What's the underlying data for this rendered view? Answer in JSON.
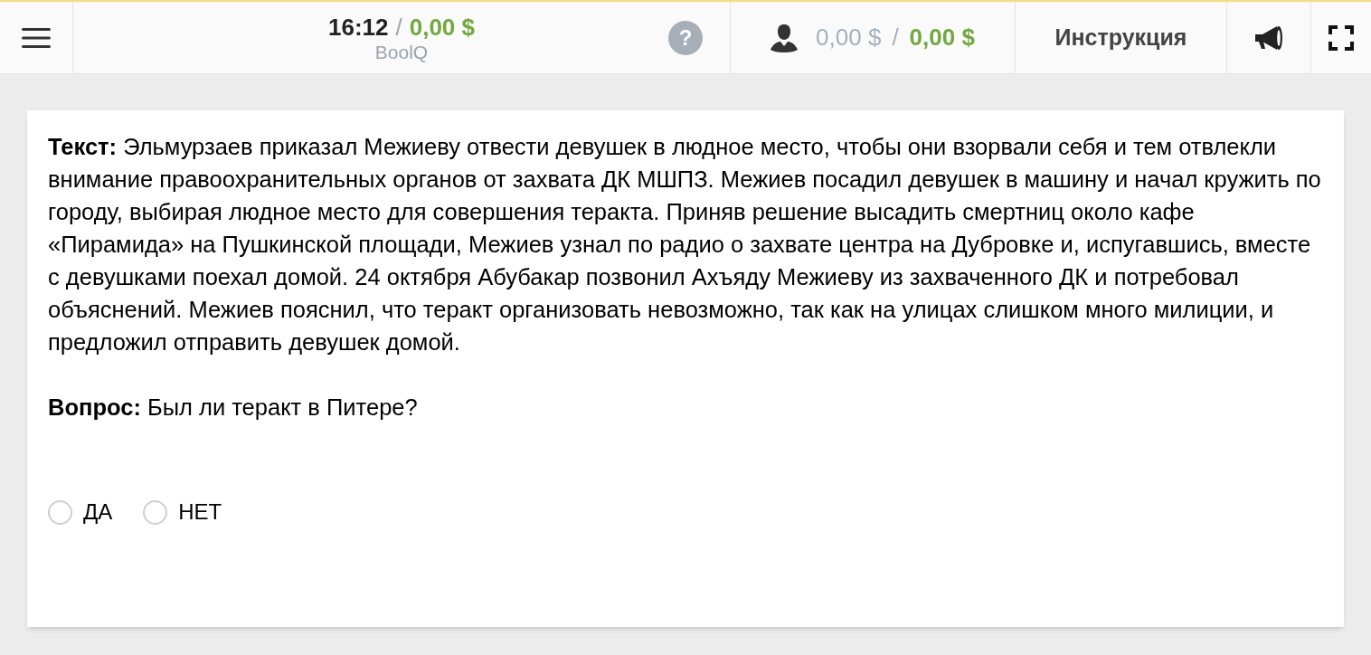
{
  "header": {
    "time": "16:12",
    "separator": "/",
    "reward": "0,00 $",
    "project": "BoolQ",
    "help": "?",
    "earned": "0,00 $",
    "earned_separator": "/",
    "balance": "0,00 $",
    "instruction": "Инструкция"
  },
  "task": {
    "text": "**Текст:** Эльмурзаев приказал Межиеву отвести девушек в людное место, чтобы они взорвали себя и тем отвлекли внимание правоохранительных органов от захвата ДК МШПЗ. Межиев посадил девушек в машину и начал кружить по городу, выбирая людное место для совершения теракта. Приняв решение высадить смертниц около кафе «Пирамида» на Пушкинской площади, Межиев узнал по радио о захвате центра на Дубровке и, испугавшись, вместе с девушками поехал домой. 24 октября Абубакар позвонил Ахъяду Межиеву из захваченного ДК и потребовал объяснений. Межиев пояснил, что теракт организовать невозможно, так как на улицах слишком много милиции, и предложил отправить девушек домой.",
    "question": "**Вопрос:** Был ли теракт в Питере?",
    "options": [
      {
        "label": "ДА",
        "selected": false
      },
      {
        "label": "НЕТ",
        "selected": false
      }
    ]
  }
}
